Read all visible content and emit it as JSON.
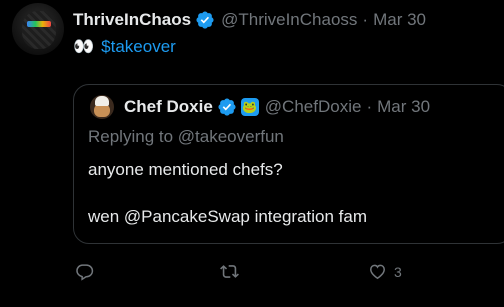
{
  "tweet": {
    "author_name": "ThriveInChaos",
    "author_handle": "@ThriveInChaoss",
    "separator": "·",
    "timestamp": "Mar 30",
    "emoji": "👀",
    "cashtag": "$takeover"
  },
  "quoted": {
    "author_name": "Chef Doxie",
    "author_handle": "@ChefDoxie",
    "separator": "·",
    "timestamp": "Mar 30",
    "badge_emoji": "🐸",
    "replying_to": "Replying to @takeoverfun",
    "line1": "anyone mentioned chefs?",
    "line2": "wen @PancakeSwap integration fam"
  },
  "actions": {
    "reply_icon": "reply-icon",
    "retweet_icon": "retweet-icon",
    "like_icon": "heart-icon",
    "like_count": "3"
  },
  "colors": {
    "background": "#000000",
    "text": "#e7e9ea",
    "muted": "#71767b",
    "link": "#1d9bf0",
    "border": "#2f3336"
  }
}
